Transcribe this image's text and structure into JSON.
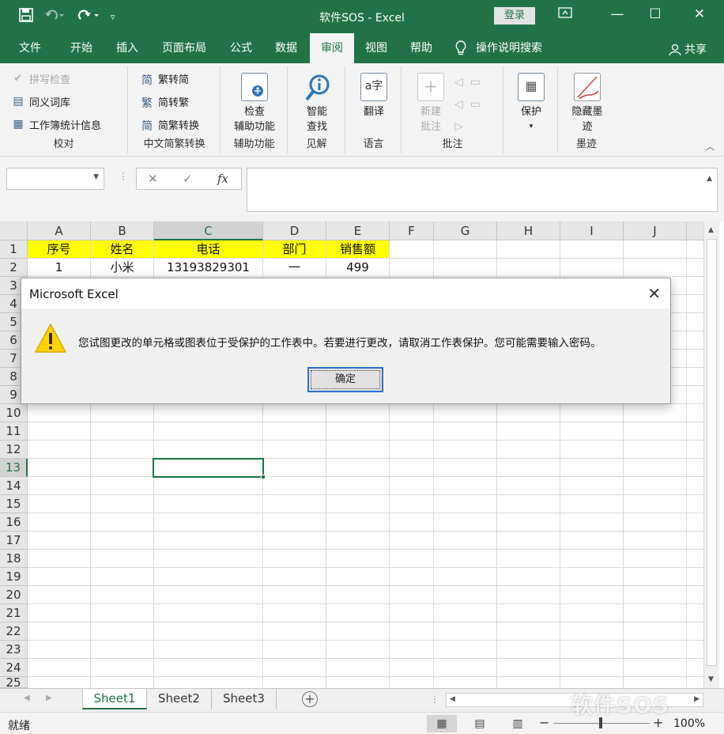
{
  "titlebar": {
    "title": "软件SOS  -  Excel",
    "login": "登录",
    "icons": [
      "save-icon",
      "undo-icon",
      "redo-icon",
      "customize-qat-icon",
      "ribbon-display-icon",
      "minimize-icon",
      "maximize-icon",
      "close-icon"
    ]
  },
  "tabs": [
    "文件",
    "开始",
    "插入",
    "页面布局",
    "公式",
    "数据",
    "审阅",
    "视图",
    "帮助"
  ],
  "active_tab": "审阅",
  "tell_me": "操作说明搜索",
  "share": "共享",
  "ribbon": {
    "proofing": {
      "label": "校对",
      "spell": "拼写检查",
      "thesaurus": "同义词库",
      "stats": "工作簿统计信息"
    },
    "chinese": {
      "label": "中文简繁转换",
      "to_simplified": "繁转简",
      "to_traditional": "简转繁",
      "convert": "简繁转换"
    },
    "accessibility": {
      "label": "辅助功能",
      "button": [
        "检查",
        "辅助功能"
      ]
    },
    "insights": {
      "label": "见解",
      "button": [
        "智能",
        "查找"
      ]
    },
    "language": {
      "label": "语言",
      "button": "翻译"
    },
    "comments": {
      "label": "批注",
      "new": [
        "新建",
        "批注"
      ]
    },
    "protect": {
      "label": "",
      "button": "保护"
    },
    "ink": {
      "label": "墨迹",
      "button": [
        "隐藏墨",
        "迹"
      ]
    }
  },
  "formula": {
    "cancel": "✕",
    "enter": "✓",
    "fx": "fx",
    "value": ""
  },
  "columns": [
    "A",
    "B",
    "C",
    "D",
    "E",
    "F",
    "G",
    "H",
    "I",
    "J"
  ],
  "rows": [
    "1",
    "2",
    "3",
    "4",
    "5",
    "6",
    "7",
    "8",
    "9",
    "10",
    "11",
    "12",
    "13",
    "14",
    "15",
    "16",
    "17",
    "18",
    "19",
    "20",
    "21",
    "22",
    "23",
    "24",
    "25"
  ],
  "selected_cell": "C13",
  "table": {
    "header": [
      "序号",
      "姓名",
      "电话",
      "部门",
      "销售额"
    ],
    "row2": [
      "1",
      "小米",
      "13193829301",
      "一",
      "499"
    ],
    "header_fill": "#ffff00"
  },
  "sheets": [
    "Sheet1",
    "Sheet2",
    "Sheet3"
  ],
  "active_sheet": "Sheet1",
  "status": {
    "ready": "就绪",
    "zoom": "100%",
    "zoom_out": "−",
    "zoom_in": "+"
  },
  "watermark": "软件SOS",
  "dialog": {
    "title": "Microsoft Excel",
    "message": "您试图更改的单元格或图表位于受保护的工作表中。若要进行更改，请取消工作表保护。您可能需要输入密码。",
    "ok": "确定",
    "icon": "warning-icon"
  },
  "colors": {
    "excel_green": "#217346",
    "ribbon_bg": "#f3f3f3",
    "warning_yellow": "#ffd200"
  }
}
